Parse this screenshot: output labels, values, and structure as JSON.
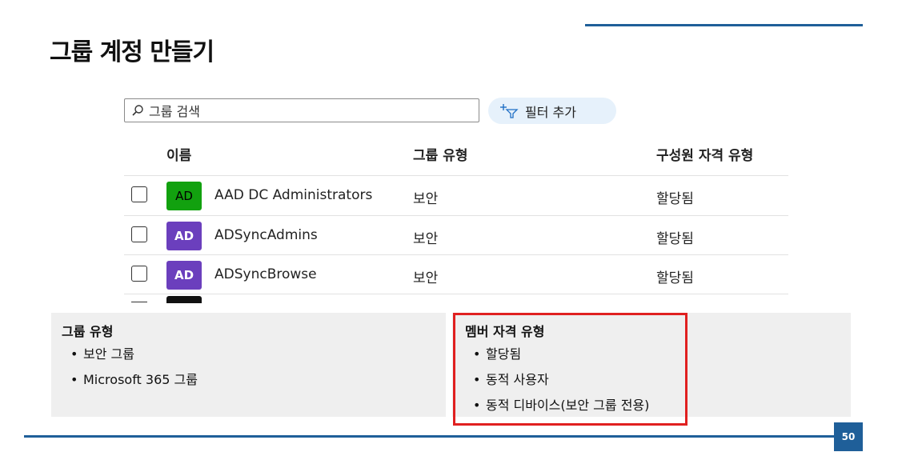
{
  "slide": {
    "title": "그룹 계정 만들기",
    "page_number": "50"
  },
  "toolbar": {
    "search_placeholder": "그룹 검색",
    "filter_label": "필터 추가"
  },
  "table": {
    "headers": {
      "name": "이름",
      "group_type": "그룹 유형",
      "membership_type": "구성원 자격 유형"
    },
    "rows": [
      {
        "avatar": "AD",
        "avatar_color": "#12a10f",
        "name": "AAD DC Administrators",
        "group_type": "보안",
        "membership_type": "할당됨"
      },
      {
        "avatar": "AD",
        "avatar_color": "#6b3fbd",
        "name": "ADSyncAdmins",
        "group_type": "보안",
        "membership_type": "할당됨"
      },
      {
        "avatar": "AD",
        "avatar_color": "#6b3fbd",
        "name": "ADSyncBrowse",
        "group_type": "보안",
        "membership_type": "할당됨"
      }
    ]
  },
  "group_types_panel": {
    "heading": "그룹 유형",
    "items": [
      "보안 그룹",
      "Microsoft 365 그룹"
    ]
  },
  "membership_panel": {
    "heading": "멤버 자격 유형",
    "items": [
      "할당됨",
      "동적 사용자",
      "동적 디바이스(보안 그룹 전용)"
    ]
  },
  "colors": {
    "accent": "#1f5f99",
    "highlight_box": "#e02020",
    "filter_button_bg": "#e6f1fb"
  }
}
